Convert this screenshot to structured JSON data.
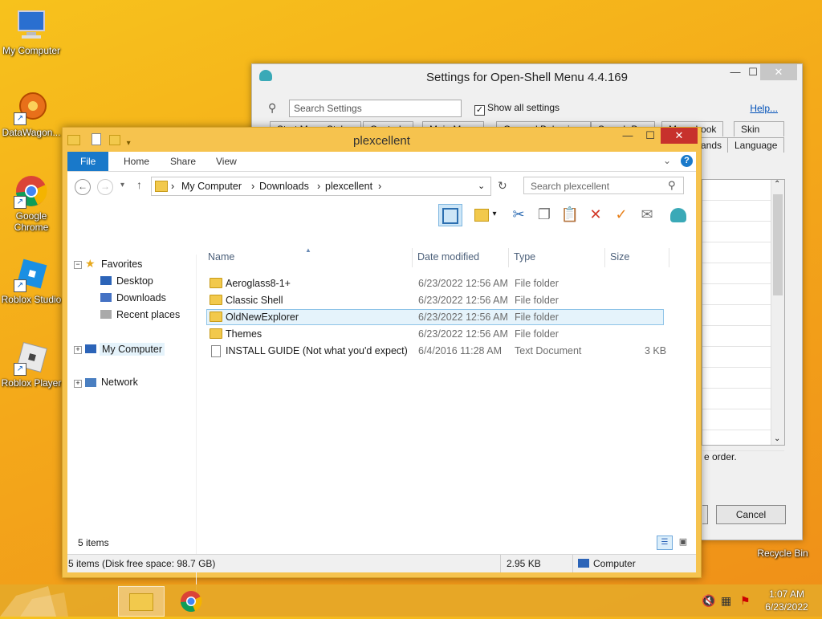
{
  "desktop": {
    "icons": [
      {
        "label": "My Computer"
      },
      {
        "label": "DataWagon..."
      },
      {
        "label": "Google Chrome"
      },
      {
        "label": "Roblox Studio"
      },
      {
        "label": "Roblox Player"
      },
      {
        "label": "Recycle Bin"
      }
    ]
  },
  "settings_window": {
    "title": "Settings for Open-Shell Menu 4.4.169",
    "search_placeholder": "Search Settings",
    "show_all_label": "Show all settings",
    "help_label": "Help...",
    "tabs_row1": [
      "Start Menu Style",
      "Controls",
      "Main Menu",
      "General Behavior",
      "Search Box",
      "Menu Look",
      "Skin"
    ],
    "tabs_row2": [
      "...ands",
      "Language"
    ],
    "order_text": "e order.",
    "cancel_label": "Cancel"
  },
  "explorer": {
    "title": "plexcellent",
    "ribbon_tabs": [
      "File",
      "Home",
      "Share",
      "View"
    ],
    "breadcrumb": [
      "My Computer",
      "Downloads",
      "plexcellent"
    ],
    "search_placeholder": "Search plexcellent",
    "nav_tree": {
      "favorites": "Favorites",
      "items": [
        "Desktop",
        "Downloads",
        "Recent places"
      ],
      "my_computer": "My Computer",
      "network": "Network"
    },
    "columns": [
      "Name",
      "Date modified",
      "Type",
      "Size"
    ],
    "files": [
      {
        "name": "Aeroglass8-1+",
        "date": "6/23/2022 12:56 AM",
        "type": "File folder",
        "size": "",
        "kind": "folder"
      },
      {
        "name": "Classic Shell",
        "date": "6/23/2022 12:56 AM",
        "type": "File folder",
        "size": "",
        "kind": "folder"
      },
      {
        "name": "OldNewExplorer",
        "date": "6/23/2022 12:56 AM",
        "type": "File folder",
        "size": "",
        "kind": "folder"
      },
      {
        "name": "Themes",
        "date": "6/23/2022 12:56 AM",
        "type": "File folder",
        "size": "",
        "kind": "folder"
      },
      {
        "name": "INSTALL GUIDE (Not what you'd expect)",
        "date": "6/4/2016 11:28 AM",
        "type": "Text Document",
        "size": "3 KB",
        "kind": "doc"
      }
    ],
    "item_count": "5 items",
    "status_left": "5 items (Disk free space: 98.7 GB)",
    "status_size": "2.95 KB",
    "status_location": "Computer"
  },
  "taskbar": {
    "time": "1:07 AM",
    "date": "6/23/2022"
  }
}
